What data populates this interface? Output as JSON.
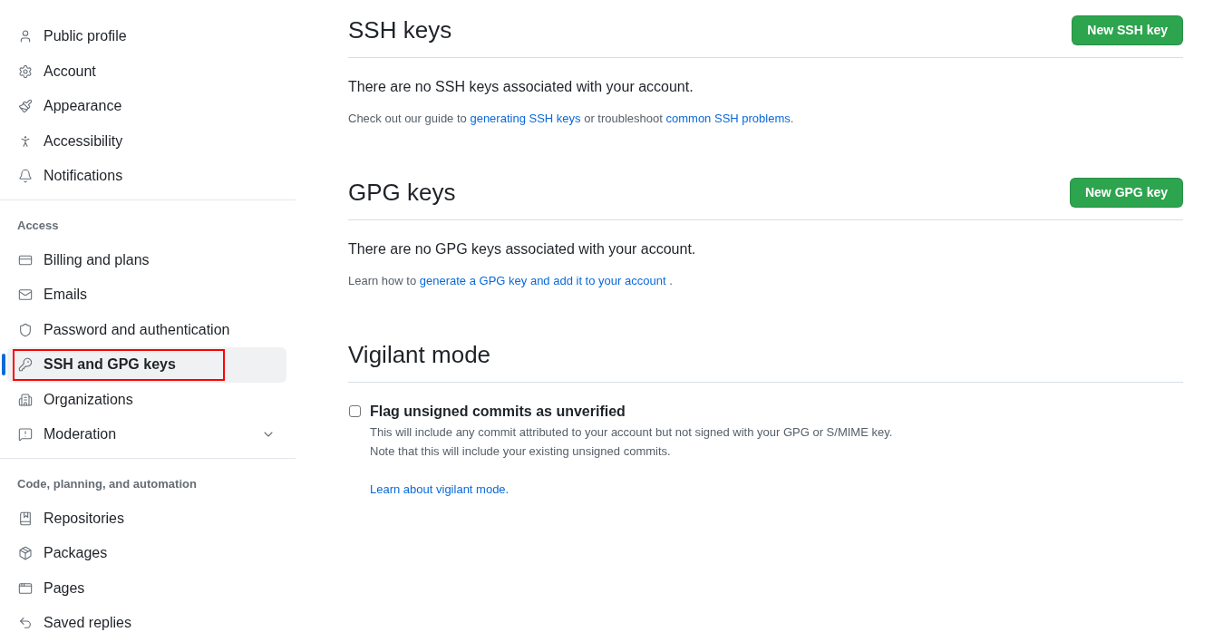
{
  "sidebar": {
    "groups": [
      {
        "items": [
          {
            "label": "Public profile",
            "selected": false,
            "outlined": false
          },
          {
            "label": "Account",
            "selected": false,
            "outlined": false
          },
          {
            "label": "Appearance",
            "selected": false,
            "outlined": false
          },
          {
            "label": "Accessibility",
            "selected": false,
            "outlined": false
          },
          {
            "label": "Notifications",
            "selected": false,
            "outlined": false
          }
        ]
      },
      {
        "heading": "Access",
        "items": [
          {
            "label": "Billing and plans",
            "selected": false,
            "outlined": false
          },
          {
            "label": "Emails",
            "selected": false,
            "outlined": false
          },
          {
            "label": "Password and authentication",
            "selected": false,
            "outlined": false
          },
          {
            "label": "SSH and GPG keys",
            "selected": true,
            "outlined": true
          },
          {
            "label": "Organizations",
            "selected": false,
            "outlined": false
          },
          {
            "label": "Moderation",
            "selected": false,
            "outlined": false,
            "expanded": false
          }
        ]
      },
      {
        "heading": "Code, planning, and automation",
        "items": [
          {
            "label": "Repositories",
            "selected": false,
            "outlined": false
          },
          {
            "label": "Packages",
            "selected": false,
            "outlined": false
          },
          {
            "label": "Pages",
            "selected": false,
            "outlined": false
          },
          {
            "label": "Saved replies",
            "selected": false,
            "outlined": false
          }
        ]
      }
    ]
  },
  "sections": [
    {
      "title": "SSH keys",
      "button": "New SSH key",
      "message": "There are no SSH keys associated with your account.",
      "help": [
        {
          "kind": "text",
          "text": "Check out our guide to "
        },
        {
          "kind": "link",
          "text": "generating SSH keys"
        },
        {
          "kind": "text",
          "text": " or troubleshoot "
        },
        {
          "kind": "link",
          "text": "common SSH problems"
        },
        {
          "kind": "text",
          "text": "."
        }
      ]
    },
    {
      "title": "GPG keys",
      "button": "New GPG key",
      "message": "There are no GPG keys associated with your account.",
      "help": [
        {
          "kind": "text",
          "text": "Learn how to "
        },
        {
          "kind": "link",
          "text": "generate a GPG key and add it to your account"
        },
        {
          "kind": "text",
          "text": " ."
        }
      ]
    },
    {
      "title": "Vigilant mode",
      "option": {
        "label": "Flag unsigned commits as unverified",
        "checked": false,
        "notes": [
          "This will include any commit attributed to your account but not signed with your GPG or S/MIME key.",
          "Note that this will include your existing unsigned commits."
        ],
        "link": "Learn about vigilant mode."
      }
    }
  ]
}
